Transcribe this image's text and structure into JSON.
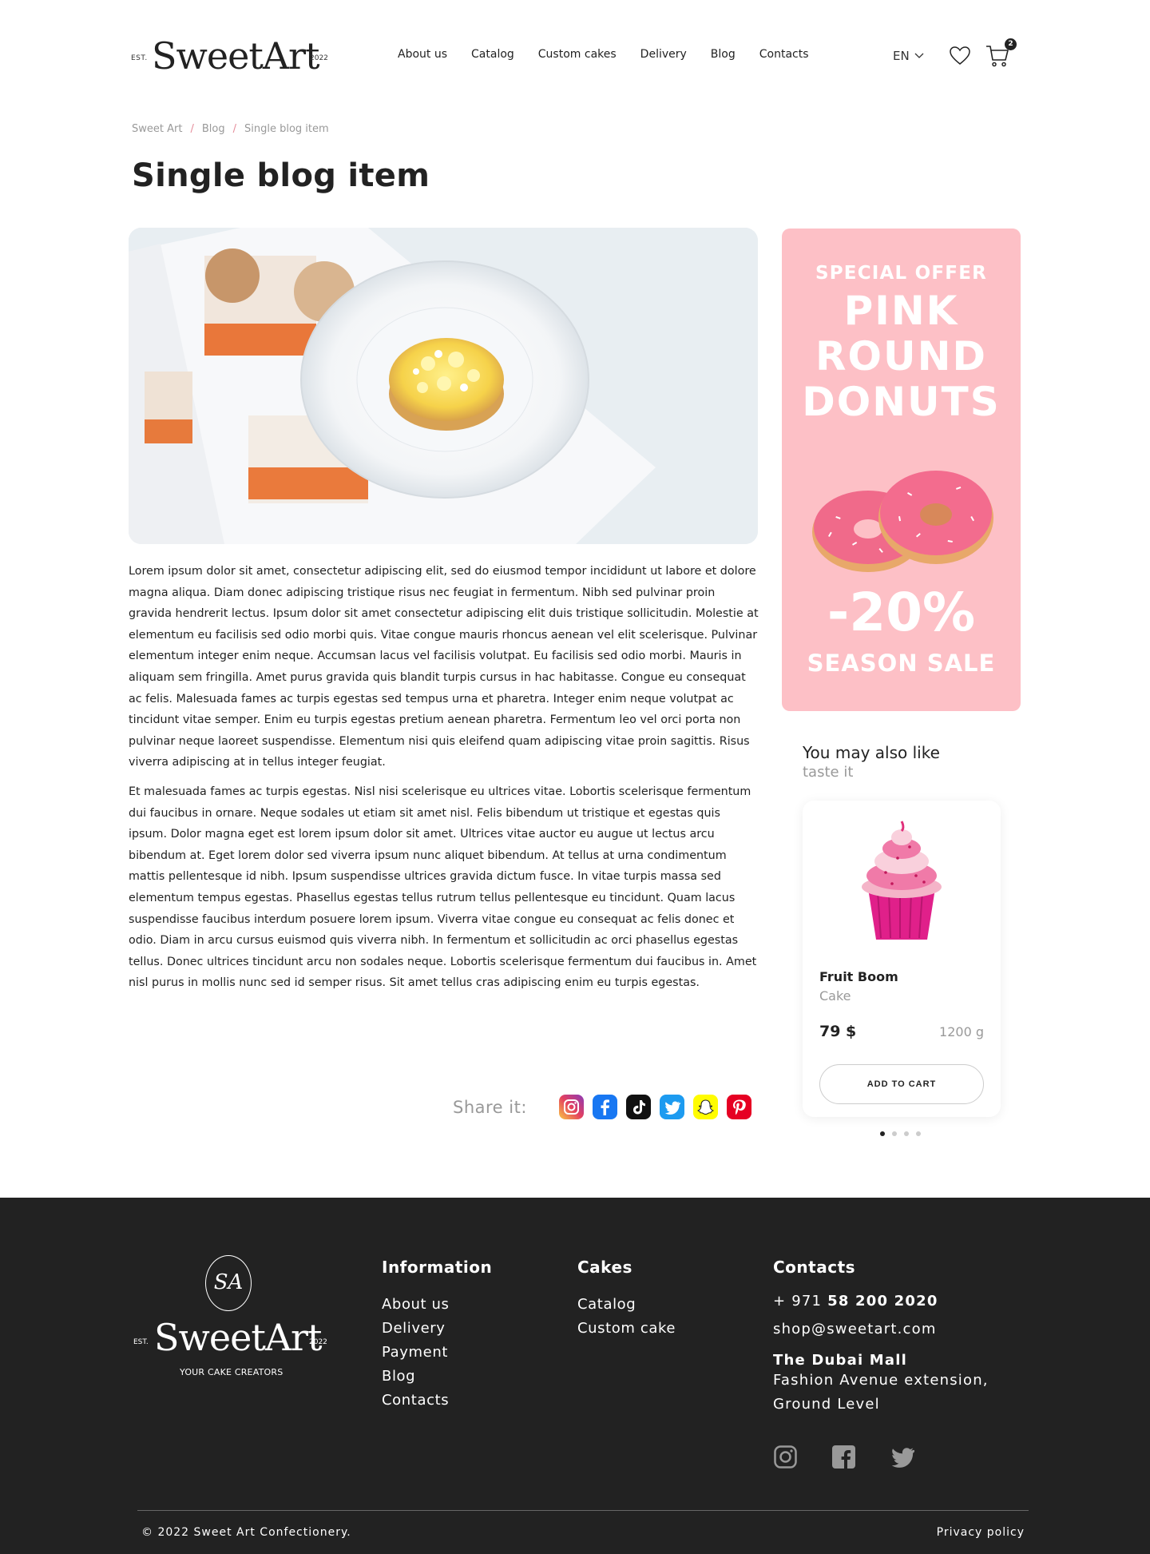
{
  "header": {
    "logo": {
      "est": "EST.",
      "word": "SweetArt",
      "year": "2022"
    },
    "nav": [
      "About us",
      "Catalog",
      "Custom cakes",
      "Delivery",
      "Blog",
      "Contacts"
    ],
    "lang": "EN",
    "cart_count": "2"
  },
  "breadcrumb": [
    "Sweet Art",
    "Blog",
    "Single blog item"
  ],
  "page_title": "Single blog item",
  "article": {
    "p1": "Lorem ipsum dolor sit amet, consectetur adipiscing elit, sed do eiusmod tempor incididunt ut labore et dolore magna aliqua. Diam donec adipiscing tristique risus nec feugiat in fermentum. Nibh sed pulvinar proin gravida hendrerit lectus. Ipsum dolor sit amet consectetur adipiscing elit duis tristique sollicitudin. Molestie at elementum eu facilisis sed odio morbi quis. Vitae congue mauris rhoncus aenean vel elit scelerisque. Pulvinar elementum integer enim neque. Accumsan lacus vel facilisis volutpat. Eu facilisis sed odio morbi. Mauris in aliquam sem fringilla. Amet purus gravida quis blandit turpis cursus in hac habitasse. Congue eu consequat ac felis. Malesuada fames ac turpis egestas sed tempus urna et pharetra. Integer enim neque volutpat ac tincidunt vitae semper. Enim eu turpis egestas pretium aenean pharetra. Fermentum leo vel orci porta non pulvinar neque laoreet suspendisse. Elementum nisi quis eleifend quam adipiscing vitae proin sagittis. Risus viverra adipiscing at in tellus integer feugiat.",
    "p2": "Et malesuada fames ac turpis egestas. Nisl nisi scelerisque eu ultrices vitae. Lobortis scelerisque fermentum dui faucibus in ornare. Neque sodales ut etiam sit amet nisl. Felis bibendum ut tristique et egestas quis ipsum. Dolor magna eget est lorem ipsum dolor sit amet. Ultrices vitae auctor eu augue ut lectus arcu bibendum at. Eget lorem dolor sed viverra ipsum nunc aliquet bibendum. At tellus at urna condimentum mattis pellentesque id nibh. Ipsum suspendisse ultrices gravida dictum fusce. In vitae turpis massa sed elementum tempus egestas. Phasellus egestas tellus rutrum tellus pellentesque eu tincidunt. Quam lacus suspendisse faucibus interdum posuere lorem ipsum. Viverra vitae congue eu consequat ac felis donec et odio. Diam in arcu cursus euismod quis viverra nibh. In fermentum et sollicitudin ac orci phasellus egestas tellus. Donec ultrices tincidunt arcu non sodales neque. Lobortis scelerisque fermentum dui faucibus in. Amet nisl purus in mollis nunc sed id semper risus. Sit amet tellus cras adipiscing enim eu turpis egestas."
  },
  "share": {
    "label": "Share it:",
    "icons": [
      "instagram-icon",
      "facebook-icon",
      "tiktok-icon",
      "twitter-icon",
      "snapchat-icon",
      "pinterest-icon"
    ]
  },
  "promo": {
    "special": "SPECIAL OFFER",
    "line1": "PINK",
    "line2": "ROUND",
    "line3": "DONUTS",
    "discount": "-20%",
    "sale": "SEASON SALE",
    "bg": "#fdc0c6"
  },
  "related": {
    "title": "You may also like",
    "subtitle": "taste it",
    "product": {
      "name": "Fruit Boom",
      "category": "Cake",
      "price": "79 $",
      "weight": "1200 g",
      "cta": "ADD TO CART"
    }
  },
  "footer": {
    "logo": {
      "mono": "SA",
      "est": "EST.",
      "word": "SweetArt",
      "year": "2022",
      "tagline": "YOUR CAKE CREATORS"
    },
    "information": {
      "title": "Information",
      "links": [
        "About us",
        "Delivery",
        "Payment",
        "Blog",
        "Contacts"
      ]
    },
    "cakes": {
      "title": "Cakes",
      "links": [
        "Catalog",
        "Custom cake"
      ]
    },
    "contacts": {
      "title": "Contacts",
      "phone_prefix": "+ 971 ",
      "phone_main": "58 200 2020",
      "email": "shop@sweetart.com",
      "mall": "The Dubai Mall",
      "address1": "Fashion Avenue extension,",
      "address2": "Ground Level"
    },
    "copyright": "© 2022 Sweet Art Confectionery.",
    "privacy": "Privacy policy",
    "bg": "#222222"
  }
}
